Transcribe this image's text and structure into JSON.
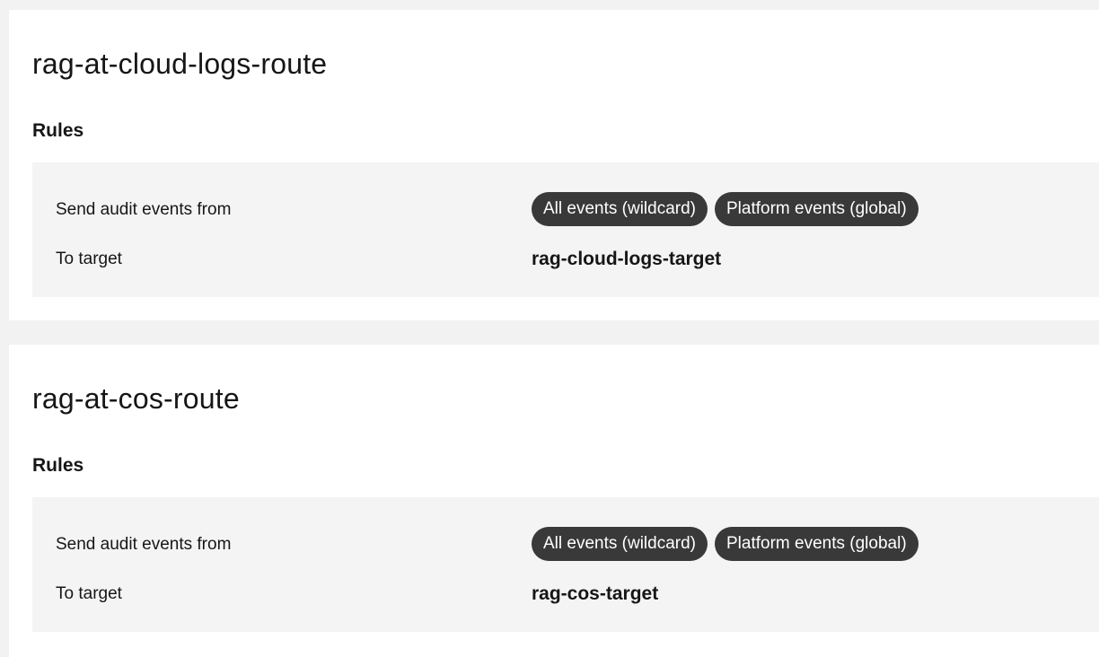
{
  "routes": [
    {
      "name": "rag-at-cloud-logs-route",
      "rules_heading": "Rules",
      "source_label": "Send audit events from",
      "source_tags": [
        "All events (wildcard)",
        "Platform events (global)"
      ],
      "target_label": "To target",
      "target_value": "rag-cloud-logs-target"
    },
    {
      "name": "rag-at-cos-route",
      "rules_heading": "Rules",
      "source_label": "Send audit events from",
      "source_tags": [
        "All events (wildcard)",
        "Platform events (global)"
      ],
      "target_label": "To target",
      "target_value": "rag-cos-target"
    }
  ],
  "colors": {
    "page_background": "#f2f2f2",
    "card_background": "#ffffff",
    "panel_background": "#f4f4f4",
    "tag_background": "#393939",
    "tag_text": "#ffffff",
    "text_primary": "#161616"
  }
}
